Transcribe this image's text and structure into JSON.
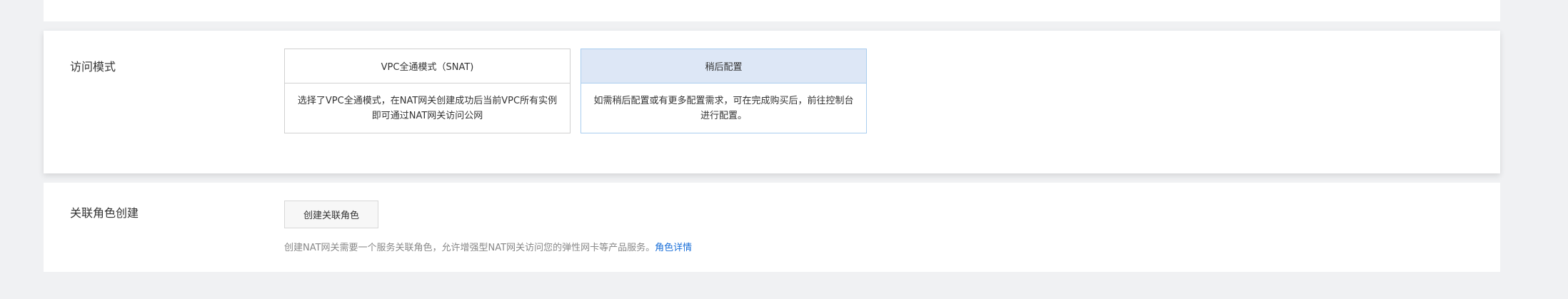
{
  "access_mode": {
    "label": "访问模式",
    "options": [
      {
        "title": "VPC全通模式（SNAT)",
        "desc": "选择了VPC全通模式，在NAT网关创建成功后当前VPC所有实例即可通过NAT网关访问公网",
        "selected": false
      },
      {
        "title": "稍后配置",
        "desc": "如需稍后配置或有更多配置需求，可在完成购买后，前往控制台进行配置。",
        "selected": true
      }
    ]
  },
  "role": {
    "label": "关联角色创建",
    "button": "创建关联角色",
    "desc": "创建NAT网关需要一个服务关联角色，允许增强型NAT网关访问您的弹性网卡等产品服务。",
    "link": "角色详情"
  }
}
